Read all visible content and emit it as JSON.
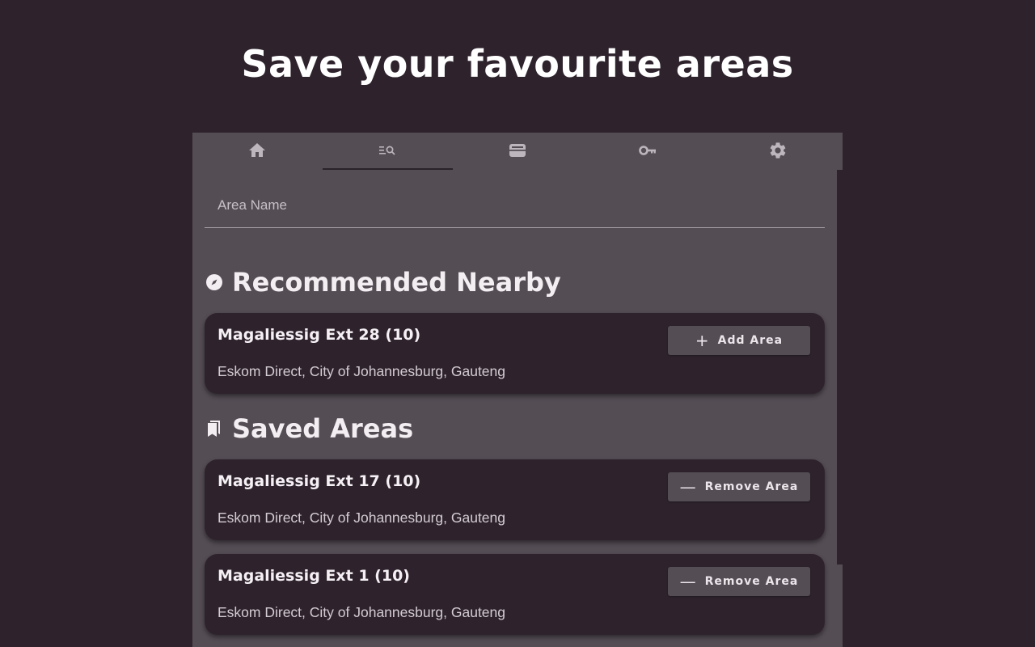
{
  "headline": "Save your favourite areas",
  "tabs": [
    {
      "icon": "home-icon",
      "active": false
    },
    {
      "icon": "search-list-icon",
      "active": true
    },
    {
      "icon": "wallet-icon",
      "active": false
    },
    {
      "icon": "key-icon",
      "active": false
    },
    {
      "icon": "gear-icon",
      "active": false
    }
  ],
  "search": {
    "placeholder": "Area Name",
    "value": ""
  },
  "recommended": {
    "title": "Recommended Nearby",
    "icon": "compass-icon",
    "items": [
      {
        "name": "Magaliessig Ext 28 (10)",
        "subtitle": "Eskom Direct, City of Johannesburg, Gauteng",
        "button_icon": "+",
        "button_label": "Add Area"
      }
    ]
  },
  "saved": {
    "title": "Saved Areas",
    "icon": "bookmarks-icon",
    "items": [
      {
        "name": "Magaliessig Ext 17 (10)",
        "subtitle": "Eskom Direct, City of Johannesburg, Gauteng",
        "button_icon": "—",
        "button_label": "Remove Area"
      },
      {
        "name": "Magaliessig Ext 1 (10)",
        "subtitle": "Eskom Direct, City of Johannesburg, Gauteng",
        "button_icon": "—",
        "button_label": "Remove Area"
      }
    ]
  },
  "colors": {
    "background": "#2e232d",
    "panel": "#544d54",
    "card": "#2e232d",
    "icon": "#bdb6bc"
  }
}
